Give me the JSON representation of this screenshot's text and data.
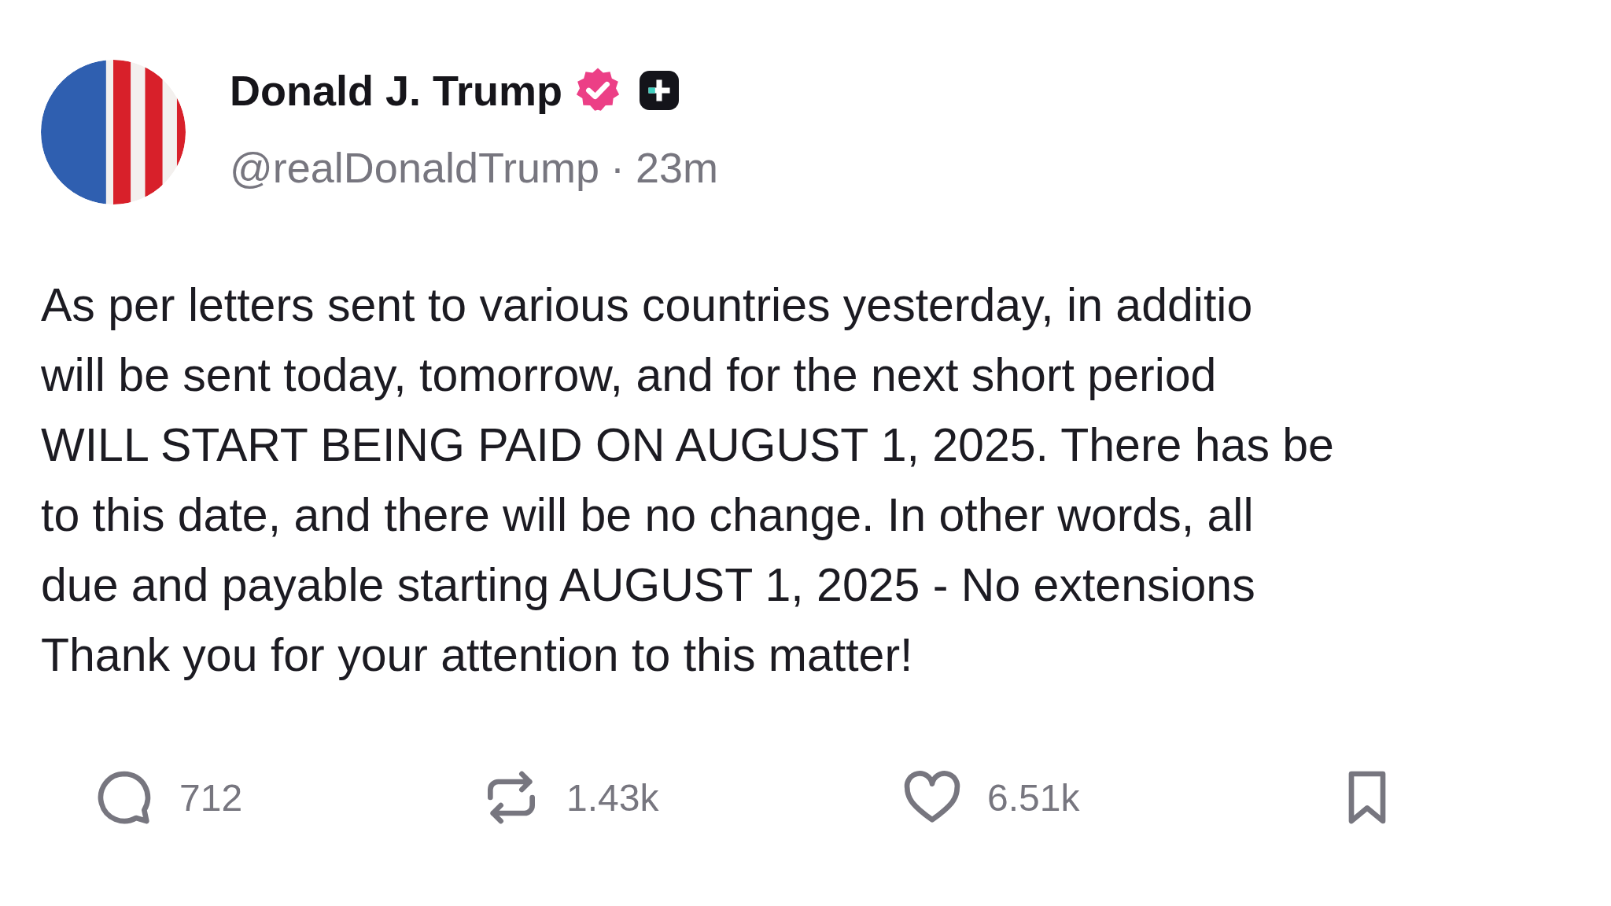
{
  "author": {
    "name": "Donald J. Trump",
    "verified": true,
    "handle": "@realDonaldTrump",
    "separator": "·",
    "time": "23m"
  },
  "body_lines": [
    "As per letters sent to various countries yesterday, in additio",
    "will be sent today, tomorrow, and for the next short period",
    "WILL START BEING PAID ON AUGUST 1, 2025. There has be",
    "to this date, and there will be no change. In other words, all",
    "due and payable starting AUGUST 1, 2025 - No extensions",
    "Thank you for your attention to this matter!"
  ],
  "actions": [
    {
      "kind": "reply",
      "count": "712"
    },
    {
      "kind": "repost",
      "count": "1.43k"
    },
    {
      "kind": "like",
      "count": "6.51k"
    },
    {
      "kind": "bookmark"
    }
  ]
}
